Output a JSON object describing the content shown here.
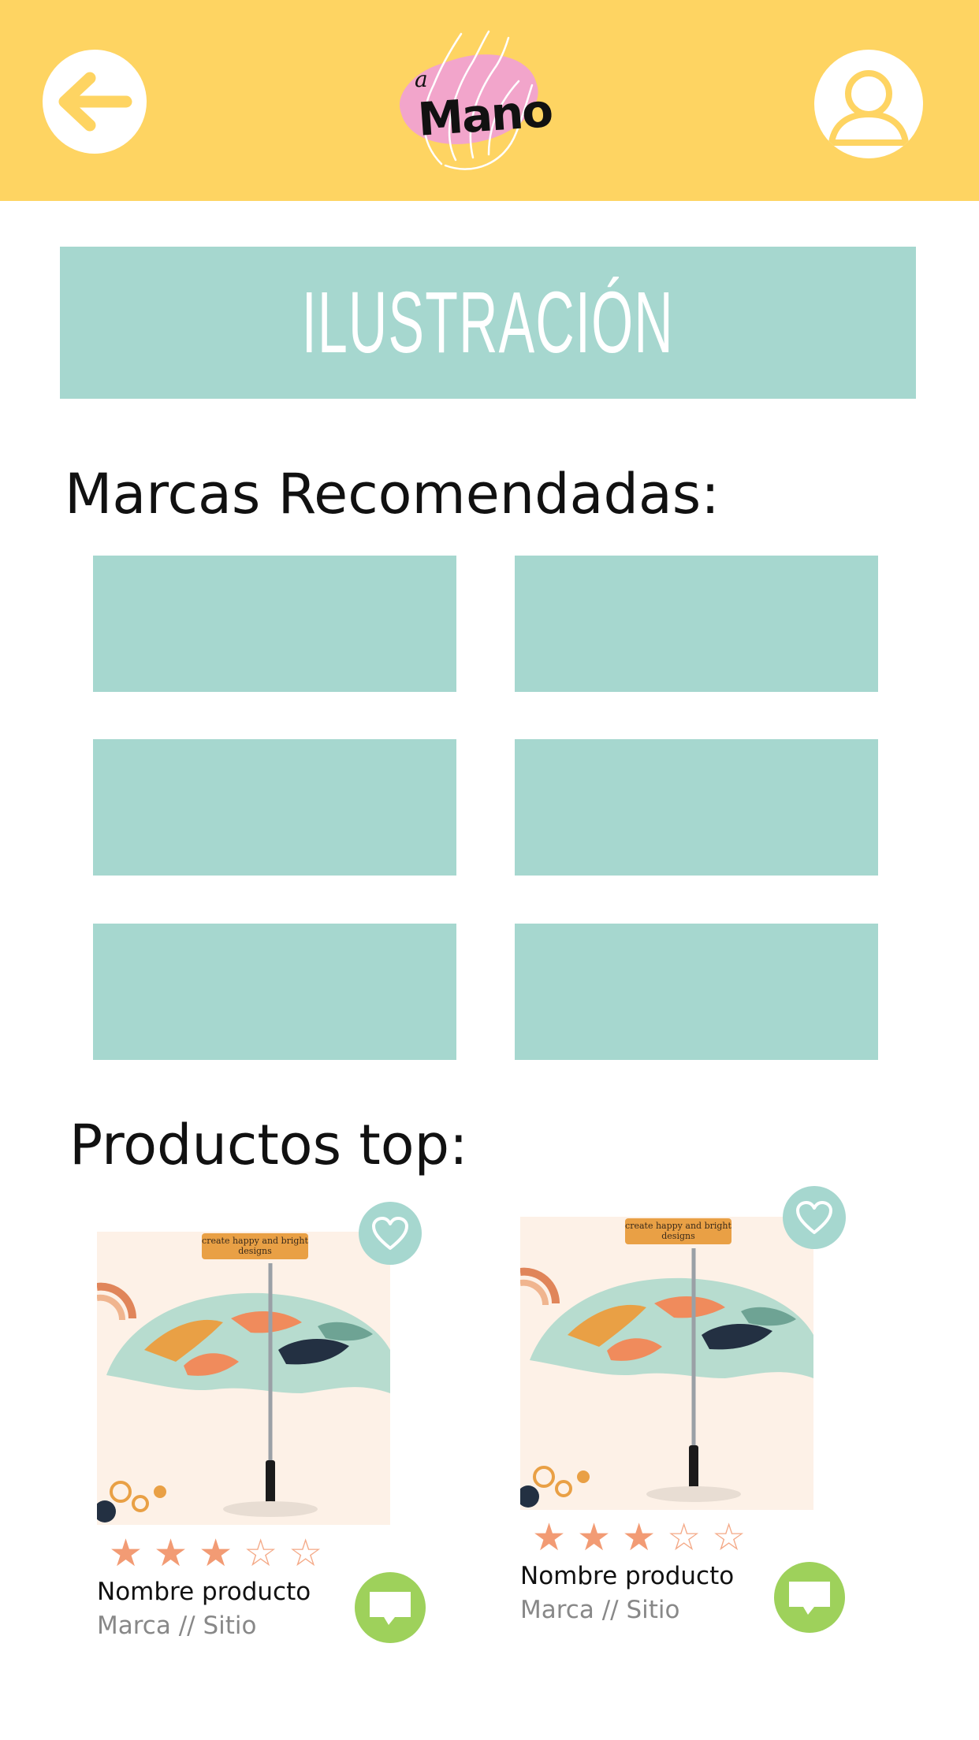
{
  "header": {
    "back_icon": "arrow-left-icon",
    "user_icon": "user-icon",
    "logo": {
      "small": "a",
      "main": "Mano"
    },
    "colors": {
      "background": "#fed462",
      "pink": "#f2a5cb"
    }
  },
  "category": {
    "title": "ILUSTRACIÓN",
    "color": "#a6d7cf"
  },
  "brands": {
    "title": "Marcas Recomendadas:",
    "tile_count": 6
  },
  "products": {
    "title": "Productos top:",
    "items": [
      {
        "image_tag": "create happy and bright designs",
        "rating": 3,
        "max_rating": 5,
        "name": "Nombre producto",
        "meta": "Marca // Sitio"
      },
      {
        "image_tag": "create happy and bright designs",
        "rating": 3,
        "max_rating": 5,
        "name": "Nombre producto",
        "meta": "Marca // Sitio"
      }
    ],
    "colors": {
      "favorite": "#a6d7cf",
      "chat": "#9ed15b",
      "star": "#f29b74"
    }
  }
}
